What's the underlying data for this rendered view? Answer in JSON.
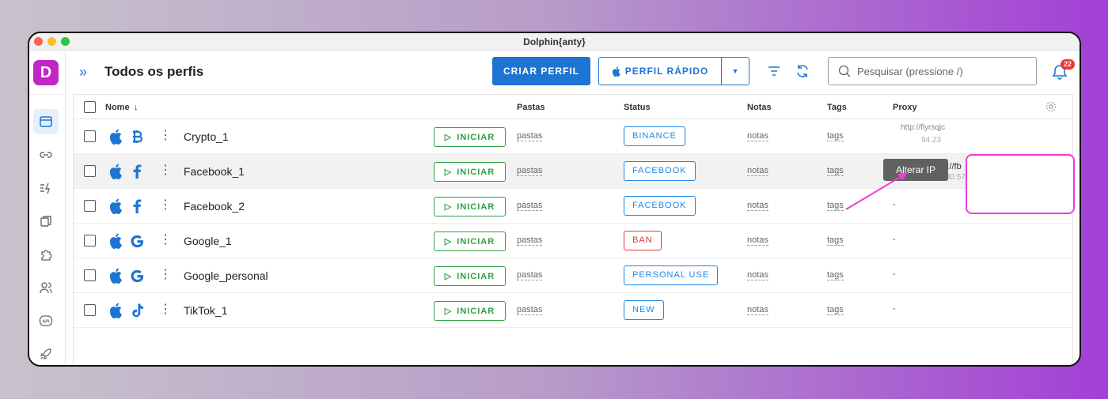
{
  "window": {
    "title": "Dolphin{anty}"
  },
  "sidebar": {
    "logo_letter": "D",
    "items": [
      {
        "icon": "browser-profiles-icon",
        "active": true
      },
      {
        "icon": "link-icon"
      },
      {
        "icon": "automation-icon"
      },
      {
        "icon": "copy-icon"
      },
      {
        "icon": "extension-icon"
      },
      {
        "icon": "users-icon"
      },
      {
        "icon": "api-icon",
        "label": "API"
      },
      {
        "icon": "rocket-icon"
      }
    ]
  },
  "header": {
    "expand_glyph": "»",
    "title": "Todos os perfis",
    "create_button": "CRIAR PERFIL",
    "quick_button": "PERFIL RÁPIDO",
    "search_placeholder": "Pesquisar (pressione /)",
    "notifications_count": "22"
  },
  "table": {
    "columns": {
      "name": "Nome",
      "sort_glyph": "↓",
      "folders": "Pastas",
      "status": "Status",
      "notes": "Notas",
      "tags": "Tags",
      "proxy": "Proxy"
    },
    "start_label": "INICIAR",
    "start_glyph": "▷",
    "kebab_glyph": "⋮",
    "rows": [
      {
        "name": "Crypto_1",
        "brand": "bitcoin-icon",
        "folders": "pastas",
        "status": "BINANCE",
        "status_color": "#1e88e5",
        "notes": "notas",
        "tags": "tags",
        "proxy": {
          "type": "http",
          "text": "http://flyrsqjc",
          "ip": "94.23"
        }
      },
      {
        "name": "Facebook_1",
        "brand": "facebook-icon",
        "folders": "pastas",
        "status": "FACEBOOK",
        "status_color": "#1e88e5",
        "notes": "notas",
        "tags": "tags",
        "highlight": true,
        "proxy": {
          "type": "socks5",
          "text": "socks5://fb",
          "ip": "37.30.57"
        }
      },
      {
        "name": "Facebook_2",
        "brand": "facebook-icon",
        "folders": "pastas",
        "status": "FACEBOOK",
        "status_color": "#1e88e5",
        "notes": "notas",
        "tags": "tags",
        "proxy": {
          "text": "-"
        }
      },
      {
        "name": "Google_1",
        "brand": "google-icon",
        "folders": "pastas",
        "status": "BAN",
        "status_color": "#e53935",
        "notes": "notas",
        "tags": "tags",
        "proxy": {
          "text": "-"
        }
      },
      {
        "name": "Google_personal",
        "brand": "google-icon",
        "folders": "pastas",
        "status": "PERSONAL USE",
        "status_color": "#1e88e5",
        "notes": "notas",
        "tags": "tags",
        "proxy": {
          "text": "-"
        }
      },
      {
        "name": "TikTok_1",
        "brand": "tiktok-icon",
        "folders": "pastas",
        "status": "NEW",
        "status_color": "#1e88e5",
        "notes": "notas",
        "tags": "tags",
        "proxy": {
          "text": "-"
        }
      }
    ]
  },
  "tooltip": {
    "text": "Alterar IP"
  },
  "colors": {
    "accent": "#1e74d2",
    "start_green": "#2ea043",
    "logo_magenta": "#c226c6",
    "annotation_pink": "#ee3ed9"
  }
}
